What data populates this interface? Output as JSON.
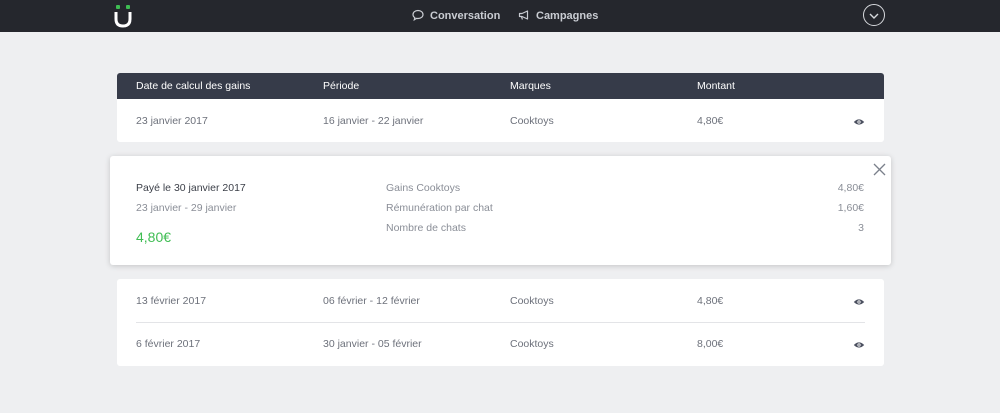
{
  "nav": {
    "conversation_label": "Conversation",
    "campaigns_label": "Campagnes"
  },
  "colors": {
    "topbar": "#25272d",
    "table_header": "#363b49",
    "accent_green": "#3fbd53",
    "logo_green": "#3fbd53"
  },
  "table": {
    "headers": [
      "Date de calcul des gains",
      "Période",
      "Marques",
      "Montant"
    ],
    "rows": [
      {
        "date": "23 janvier 2017",
        "period": "16 janvier - 22 janvier",
        "brand": "Cooktoys",
        "amount": "4,80€"
      },
      {
        "date": "13 février 2017",
        "period": "06 février - 12 février",
        "brand": "Cooktoys",
        "amount": "4,80€"
      },
      {
        "date": "6 février 2017",
        "period": "30 janvier - 05 février",
        "brand": "Cooktoys",
        "amount": "8,00€"
      }
    ]
  },
  "detail": {
    "title": "Payé le 30 janvier 2017",
    "period": "23 janvier - 29 janvier",
    "amount": "4,80€",
    "lines": [
      {
        "label": "Gains Cooktoys",
        "value": "4,80€"
      },
      {
        "label": "Rémunération par chat",
        "value": "1,60€"
      },
      {
        "label": "Nombre de chats",
        "value": "3"
      }
    ]
  },
  "icons": {
    "nav_conversation": "speech-bubble-icon",
    "nav_campaigns": "megaphone-icon",
    "row_action": "eye-icon",
    "close": "close-icon",
    "user_menu": "chevron-down-icon"
  }
}
